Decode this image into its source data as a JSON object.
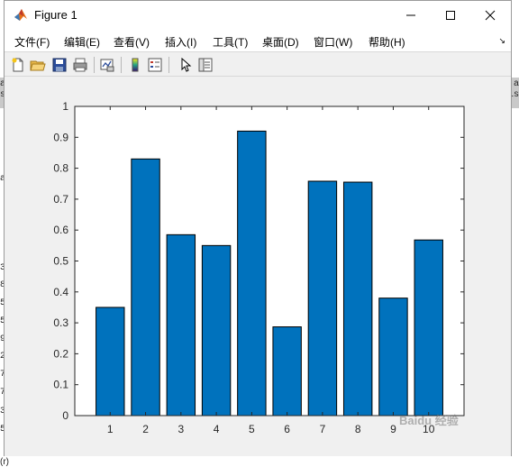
{
  "window": {
    "title": "Figure 1",
    "controls": {
      "minimize": "minimize",
      "maximize": "maximize",
      "close": "close"
    }
  },
  "menubar": {
    "items": [
      "文件(F)",
      "编辑(E)",
      "查看(V)",
      "插入(I)",
      "工具(T)",
      "桌面(D)",
      "窗口(W)",
      "帮助(H)"
    ]
  },
  "toolbar": {
    "buttons": [
      "new-figure",
      "open-file",
      "save",
      "print",
      "link-plot",
      "insert-colorbar",
      "insert-legend",
      "edit-plot",
      "property-inspector"
    ]
  },
  "background": {
    "left_chars": [
      "a",
      "s",
      "a",
      "3",
      "8",
      "5",
      "5",
      "9",
      "2",
      "7",
      "7",
      "3",
      "5"
    ],
    "right_chars": [
      "a",
      "is"
    ],
    "bottom_text": "(r)"
  },
  "colors": {
    "bar_fill": "#0072BD",
    "bar_edge": "#000000",
    "axes_bg": "#ffffff",
    "figure_bg": "#f0f0f0"
  },
  "chart_data": {
    "type": "bar",
    "categories": [
      "1",
      "2",
      "3",
      "4",
      "5",
      "6",
      "7",
      "8",
      "9",
      "10"
    ],
    "values": [
      0.35,
      0.83,
      0.585,
      0.55,
      0.92,
      0.287,
      0.758,
      0.755,
      0.38,
      0.568
    ],
    "ylim": [
      0,
      1
    ],
    "xlim": [
      0,
      11
    ],
    "yticks": [
      "0",
      "0.1",
      "0.2",
      "0.3",
      "0.4",
      "0.5",
      "0.6",
      "0.7",
      "0.8",
      "0.9",
      "1"
    ],
    "title": "",
    "xlabel": "",
    "ylabel": "",
    "grid": false,
    "legend": "none"
  },
  "watermark": "Baidu 经验"
}
